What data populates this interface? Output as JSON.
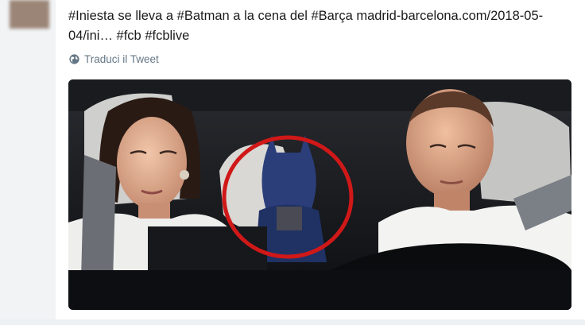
{
  "tweet": {
    "line1": [
      {
        "t": "#Iniesta"
      },
      {
        "t": " se lleva a "
      },
      {
        "t": "#Batman"
      },
      {
        "t": " a la cena del "
      },
      {
        "t": "#Barça"
      },
      {
        "t": " madrid-barcelona.com/2018-05-"
      }
    ],
    "line2": [
      {
        "t": "04/ini…"
      },
      {
        "t": " "
      },
      {
        "t": "#fcb"
      },
      {
        "t": " "
      },
      {
        "t": "#fcblive"
      }
    ]
  },
  "translate_label": "Traduci il Tweet",
  "icons": {
    "translate": "globe-icon"
  },
  "colors": {
    "text": "#14171a",
    "muted": "#657786",
    "highlight_circle": "#d01818"
  }
}
